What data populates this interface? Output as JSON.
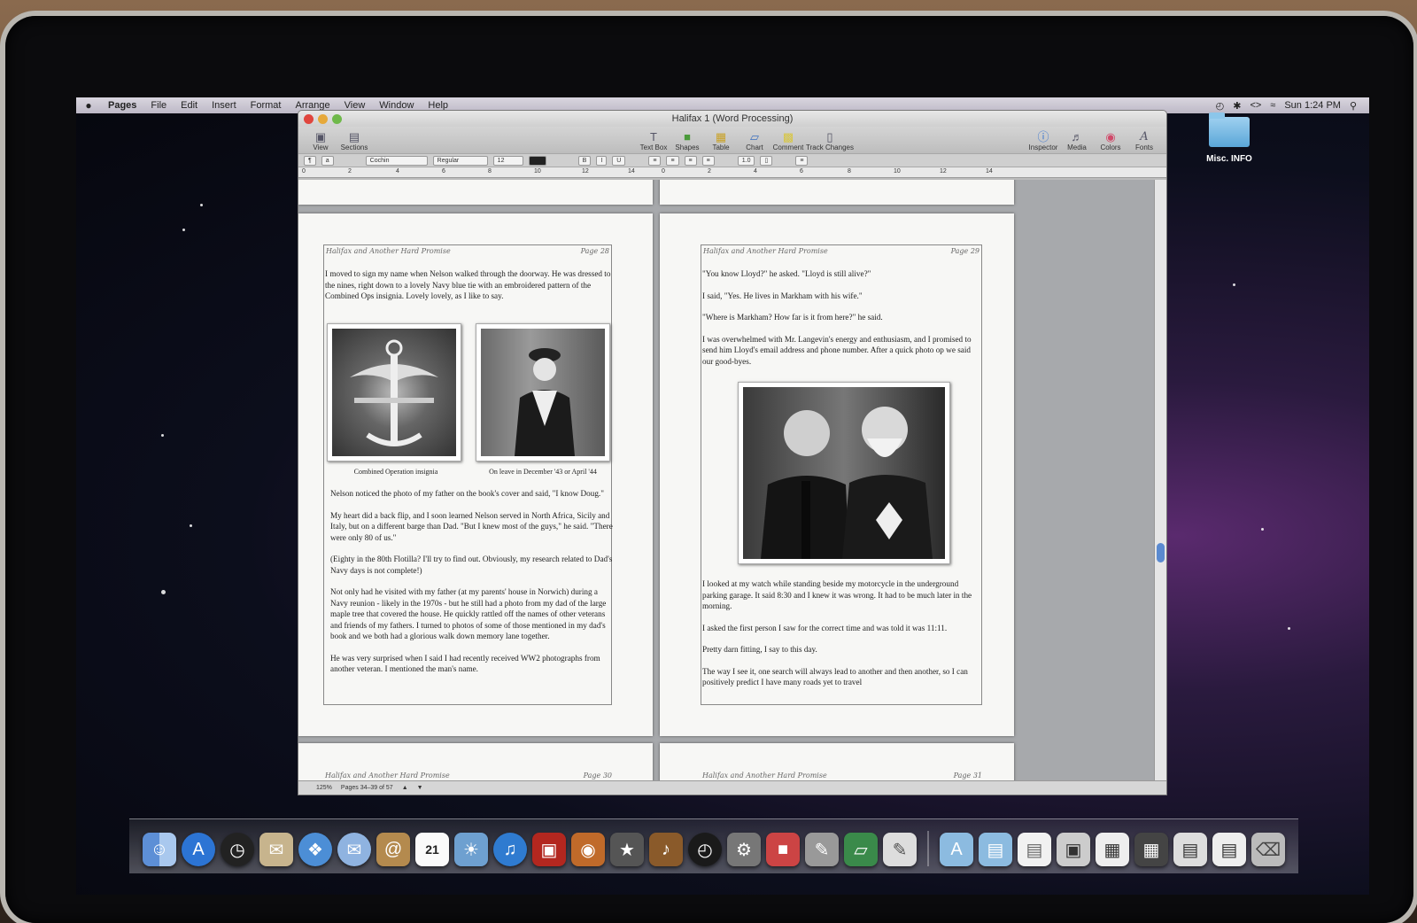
{
  "menubar": {
    "apple": "",
    "items": [
      "Pages",
      "File",
      "Edit",
      "Insert",
      "Format",
      "Arrange",
      "View",
      "Window",
      "Help"
    ],
    "clock": "Sun 1:24 PM"
  },
  "window": {
    "title": "Halifax 1 (Word Processing)",
    "toolbar_left": [
      {
        "label": "View",
        "icon": "view-icon"
      },
      {
        "label": "Sections",
        "icon": "sections-icon"
      }
    ],
    "toolbar_center": [
      {
        "label": "Text Box",
        "icon": "text-box-icon"
      },
      {
        "label": "Shapes",
        "icon": "shapes-icon"
      },
      {
        "label": "Table",
        "icon": "table-icon"
      },
      {
        "label": "Chart",
        "icon": "chart-icon"
      },
      {
        "label": "Comment",
        "icon": "comment-icon"
      },
      {
        "label": "Track Changes",
        "icon": "track-changes-icon"
      }
    ],
    "toolbar_right": [
      {
        "label": "Inspector",
        "icon": "inspector-icon"
      },
      {
        "label": "Media",
        "icon": "media-icon"
      },
      {
        "label": "Colors",
        "icon": "colors-icon"
      },
      {
        "label": "Fonts",
        "icon": "fonts-icon"
      }
    ],
    "format": {
      "font": "Cochin",
      "style": "Regular",
      "size": "12",
      "line_spacing": "1.0"
    },
    "ruler_left": [
      "0",
      "2",
      "4",
      "6",
      "8",
      "10",
      "12",
      "14"
    ],
    "ruler_right": [
      "0",
      "2",
      "4",
      "6",
      "8",
      "10",
      "12",
      "14"
    ],
    "status": {
      "zoom": "125%",
      "pages": "Pages 34–39 of 57"
    }
  },
  "left_page": {
    "header_title": "Halifax and Another Hard Promise",
    "header_page": "Page 28",
    "intro": "I moved to sign my name when Nelson walked through the doorway. He was dressed to the nines, right down to a lovely Navy blue tie with an embroidered pattern of the Combined Ops insignia. Lovely lovely, as I like to say.",
    "caption_1": "Combined Operation insignia",
    "caption_2": "On leave in December '43 or April '44",
    "paragraphs": [
      "Nelson noticed the photo of my father on the book's cover and said, \"I know Doug.\"",
      "My heart did a back flip, and I soon learned Nelson served in North Africa, Sicily and Italy, but on a different barge than Dad. \"But I knew most of the guys,\" he said. \"There were only 80 of us.\"",
      "(Eighty in the 80th Flotilla? I'll try to find out. Obviously, my research related to Dad's Navy days is not complete!)",
      "Not only had he visited with my father (at my parents' house in Norwich) during a Navy reunion - likely in the 1970s - but he still had a photo from my dad of the large maple tree that covered the house. He quickly rattled off the names of other veterans and friends of my fathers. I turned to photos of some of those mentioned in my dad's book and we both had a glorious walk down memory lane together.",
      "He was very surprised when I said I had recently received WW2 photographs from another veteran. I mentioned the man's name."
    ]
  },
  "right_page": {
    "header_title": "Halifax and Another Hard Promise",
    "header_page": "Page 29",
    "paragraphs_top": [
      "\"You know Lloyd?\" he asked. \"Lloyd is still alive?\"",
      "I said, \"Yes. He lives in Markham with his wife.\"",
      "\"Where is Markham? How far is it from here?\" he said.",
      "I was overwhelmed with Mr. Langevin's energy and enthusiasm, and I promised to send him Lloyd's email address and phone number. After a quick photo op we said our good-byes."
    ],
    "paragraphs_bottom": [
      "I looked at my watch while standing beside my motorcycle in the underground parking garage. It said 8:30 and I knew it was wrong. It had to be much later in the morning.",
      "I asked the first person I saw for the correct time and was told it was 11:11.",
      "Pretty darn fitting, I say to this day.",
      "The way I see it, one search will always lead to another and then another, so I can positively predict I have many roads yet to travel"
    ]
  },
  "next_pages": {
    "left_header_title": "Halifax and Another Hard Promise",
    "left_header_page": "Page 30",
    "right_header_title": "Halifax and Another Hard Promise",
    "right_header_page": "Page 31"
  },
  "desktop": {
    "folder_label": "Misc. INFO"
  },
  "dock": {
    "calendar_day": "21",
    "items": [
      "finder-icon",
      "app-store-icon",
      "dashboard-icon",
      "mail-stamp-icon",
      "safari-icon",
      "ichat-icon",
      "address-book-icon",
      "ical-icon",
      "iphoto-icon",
      "itunes-icon",
      "photo-booth-icon",
      "iphoto-2-icon",
      "imovie-star-icon",
      "garageband-icon",
      "time-machine-icon",
      "system-preferences-icon",
      "keynote-icon",
      "script-editor-icon",
      "numbers-icon",
      "pages-icon"
    ],
    "right_items": [
      "applications-folder-icon",
      "documents-folder-icon",
      "file-icon",
      "screenshot-1-icon",
      "screenshot-2-icon",
      "screenshot-3-icon",
      "screenshot-4-icon",
      "screenshot-5-icon",
      "trash-icon"
    ]
  }
}
